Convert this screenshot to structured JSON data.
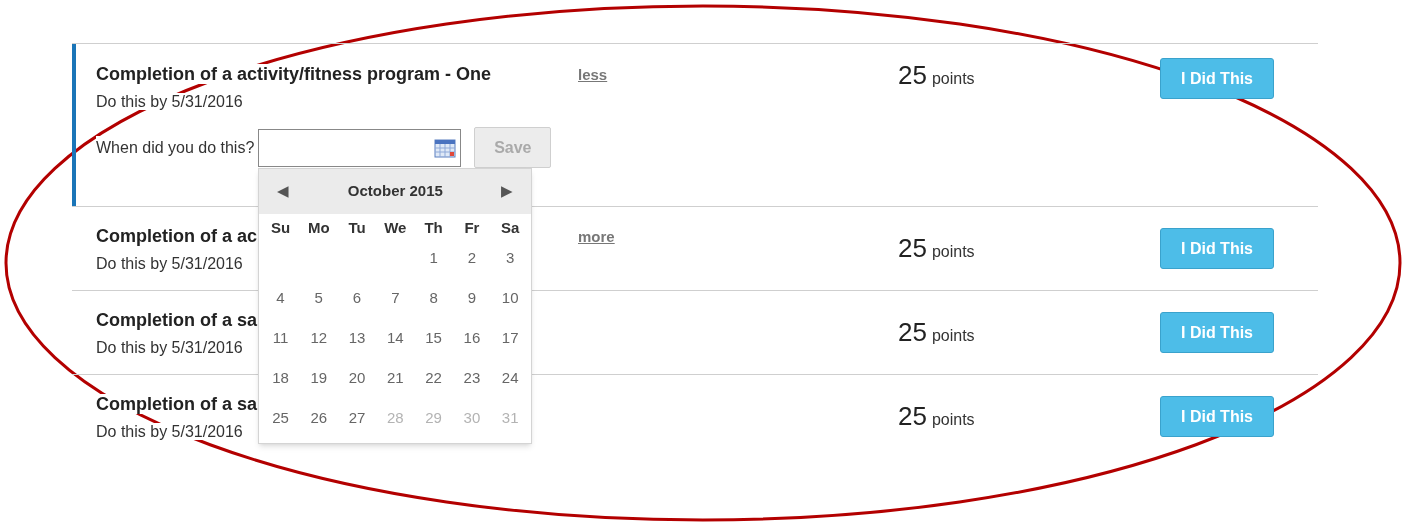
{
  "challenges": [
    {
      "title": "Completion of a activity/fitness program - One",
      "toggle_link": "less",
      "due": "Do this by 5/31/2016",
      "points": "25",
      "points_unit": "points",
      "button": "I Did This",
      "expanded": true,
      "date_form": {
        "label": "When did you do this?",
        "save": {
          "label": "Save",
          "disabled": true
        },
        "calendar": {
          "month": "October 2015",
          "prev": "◀",
          "next": "▶",
          "weekdays": [
            "Su",
            "Mo",
            "Tu",
            "We",
            "Th",
            "Fr",
            "Sa"
          ],
          "weeks": [
            [
              {
                "label": "1",
                "disabled": false
              },
              {
                "label": "2",
                "disabled": false
              },
              {
                "label": "3",
                "disabled": false
              }
            ],
            [
              {
                "label": "4",
                "disabled": false
              },
              {
                "label": "5",
                "disabled": false
              },
              {
                "label": "6",
                "disabled": false
              },
              {
                "label": "7",
                "disabled": false
              },
              {
                "label": "8",
                "disabled": false
              },
              {
                "label": "9",
                "disabled": false
              },
              {
                "label": "10",
                "disabled": false
              }
            ],
            [
              {
                "label": "11",
                "disabled": false
              },
              {
                "label": "12",
                "disabled": false
              },
              {
                "label": "13",
                "disabled": false
              },
              {
                "label": "14",
                "disabled": false
              },
              {
                "label": "15",
                "disabled": false
              },
              {
                "label": "16",
                "disabled": false
              },
              {
                "label": "17",
                "disabled": false
              }
            ],
            [
              {
                "label": "18",
                "disabled": false
              },
              {
                "label": "19",
                "disabled": false
              },
              {
                "label": "20",
                "disabled": false
              },
              {
                "label": "21",
                "disabled": false
              },
              {
                "label": "22",
                "disabled": false
              },
              {
                "label": "23",
                "disabled": false
              },
              {
                "label": "24",
                "disabled": false
              }
            ],
            [
              {
                "label": "25",
                "disabled": false
              },
              {
                "label": "26",
                "disabled": false
              },
              {
                "label": "27",
                "disabled": false
              },
              {
                "label": "28",
                "disabled": true
              },
              {
                "label": "29",
                "disabled": true
              },
              {
                "label": "30",
                "disabled": true
              },
              {
                "label": "31",
                "disabled": true
              }
            ]
          ]
        }
      }
    },
    {
      "title": "Completion of a ac",
      "toggle_link": "more",
      "due": "Do this by 5/31/2016",
      "points": "25",
      "points_unit": "points",
      "button": "I Did This",
      "expanded": false
    },
    {
      "title": "Completion of a sa",
      "due": "Do this by 5/31/2016",
      "points": "25",
      "points_unit": "points",
      "button": "I Did This",
      "expanded": false
    },
    {
      "title": "Completion of a sa",
      "due": "Do this by 5/31/2016",
      "points": "25",
      "points_unit": "points",
      "button": "I Did This",
      "expanded": false
    }
  ]
}
